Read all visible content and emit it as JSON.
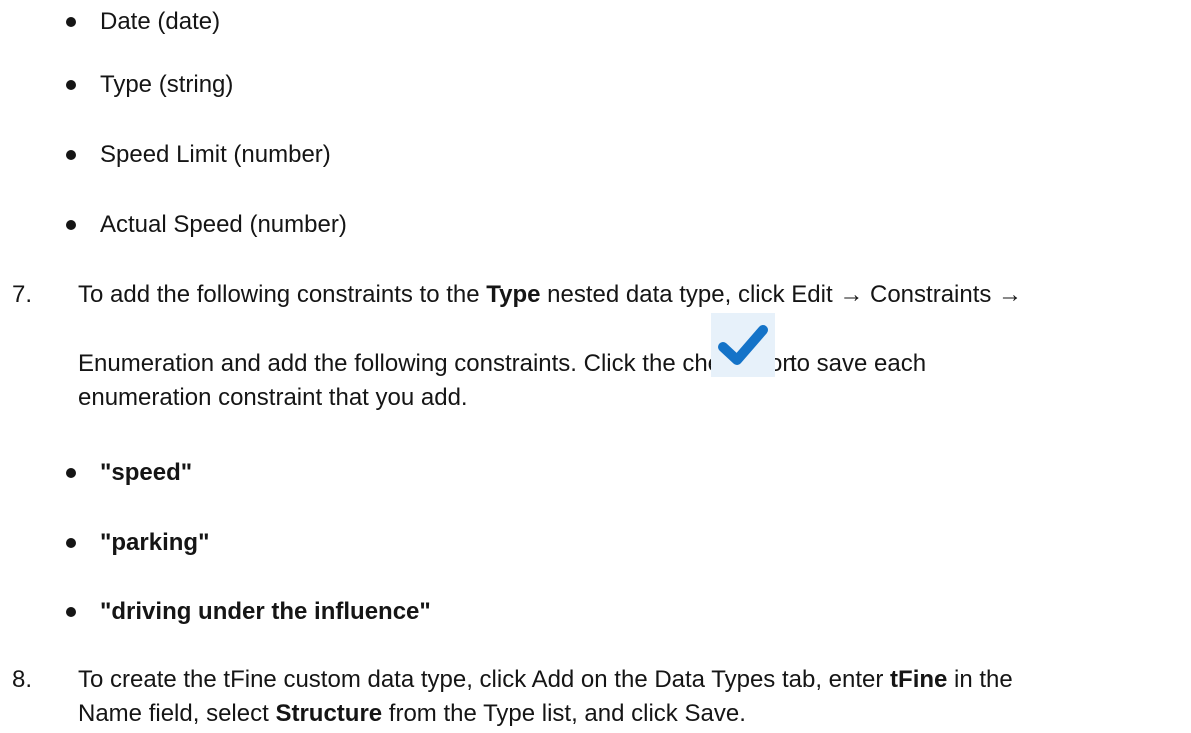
{
  "field_list": [
    {
      "name": "Date",
      "type": "(date)"
    },
    {
      "name": "Type",
      "type": "(string)"
    },
    {
      "name": "Speed Limit",
      "type": "(number)"
    },
    {
      "name": "Actual Speed",
      "type": "(number)"
    }
  ],
  "step7": {
    "number": "7.",
    "t1": "To add the following constraints to the ",
    "type_word": "Type",
    "t2": " nested data type, click ",
    "edit": "Edit",
    "arrow1": " → ",
    "constraints": "Constraints",
    "arrow2": " →",
    "enumeration": "Enumeration",
    "t3": " and add the following constraints. Click the check icon",
    "t4": "to save each",
    "t5": "enumeration constraint that you add.",
    "check_icon": "check-icon",
    "check_color": "#1473c8",
    "constraints_list": [
      "\"speed\"",
      "\"parking\"",
      "\"driving under the influence\""
    ]
  },
  "step8": {
    "number": "8.",
    "t1": "To create the ",
    "tfine1": "tFine",
    "t2": " custom data type, click ",
    "add": "Add",
    "t3": " on the ",
    "data_types": "Data Types",
    "t4": " tab, enter ",
    "tfine2": "tFine",
    "t5": " in the",
    "name": "Name",
    "t6": " field, select ",
    "structure": "Structure",
    "t7": " from the ",
    "type": "Type",
    "t8": " list, and click ",
    "save": "Save",
    "t9": "."
  }
}
